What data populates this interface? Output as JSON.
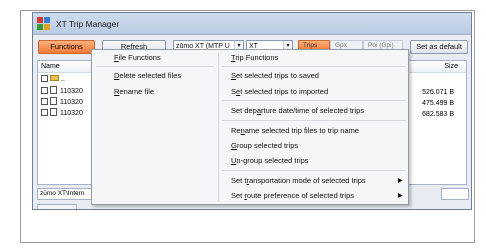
{
  "window": {
    "title": "XT Trip Manager"
  },
  "toolbar": {
    "functions_label": "Functions",
    "refresh_label": "Refresh",
    "device_select": "zūmo XT (MTP U",
    "product_select": "XT",
    "trips_toggle": "Trips",
    "gpx_toggle": "Gpx",
    "poi_toggle": "Poi (Gpi)",
    "save_default_label": "Set as default"
  },
  "filelist": {
    "col_name": "Name",
    "col_size": "Size",
    "parent_entry": "..",
    "rows": [
      {
        "name": "110320",
        "size": "526.071 B"
      },
      {
        "name": "110320",
        "size": "475.499 B"
      },
      {
        "name": "110320",
        "size": "682.583 B"
      }
    ]
  },
  "pathbar": {
    "value": "zūmo XT\\Intern"
  },
  "menu": {
    "left": {
      "file_functions": {
        "pre": "",
        "key": "F",
        "post": "ile Functions"
      },
      "delete_selected": {
        "pre": "",
        "key": "D",
        "post": "elete selected files"
      },
      "rename_file": {
        "pre": "",
        "key": "R",
        "post": "ename file"
      }
    },
    "right": {
      "trip_functions": {
        "pre": "",
        "key": "T",
        "post": "rip Functions"
      },
      "set_saved": {
        "pre": "",
        "key": "S",
        "post": "et selected trips to saved"
      },
      "set_imported": {
        "pre": "S",
        "key": "e",
        "post": "t selected trips to imported"
      },
      "set_departure": {
        "pre": "Set dep",
        "key": "a",
        "post": "rture date/time of selected trips"
      },
      "rename_trip": {
        "pre": "Re",
        "key": "n",
        "post": "ame selected trip files to trip name"
      },
      "group": {
        "pre": "",
        "key": "G",
        "post": "roup selected trips"
      },
      "ungroup": {
        "pre": "",
        "key": "U",
        "post": "n-group selected trips"
      },
      "transport_mode": {
        "pre": "Set t",
        "key": "r",
        "post": "ansportation mode of selected trips"
      },
      "route_pref": {
        "pre": "Set ",
        "key": "r",
        "post": "oute preference of selected trips"
      }
    }
  }
}
